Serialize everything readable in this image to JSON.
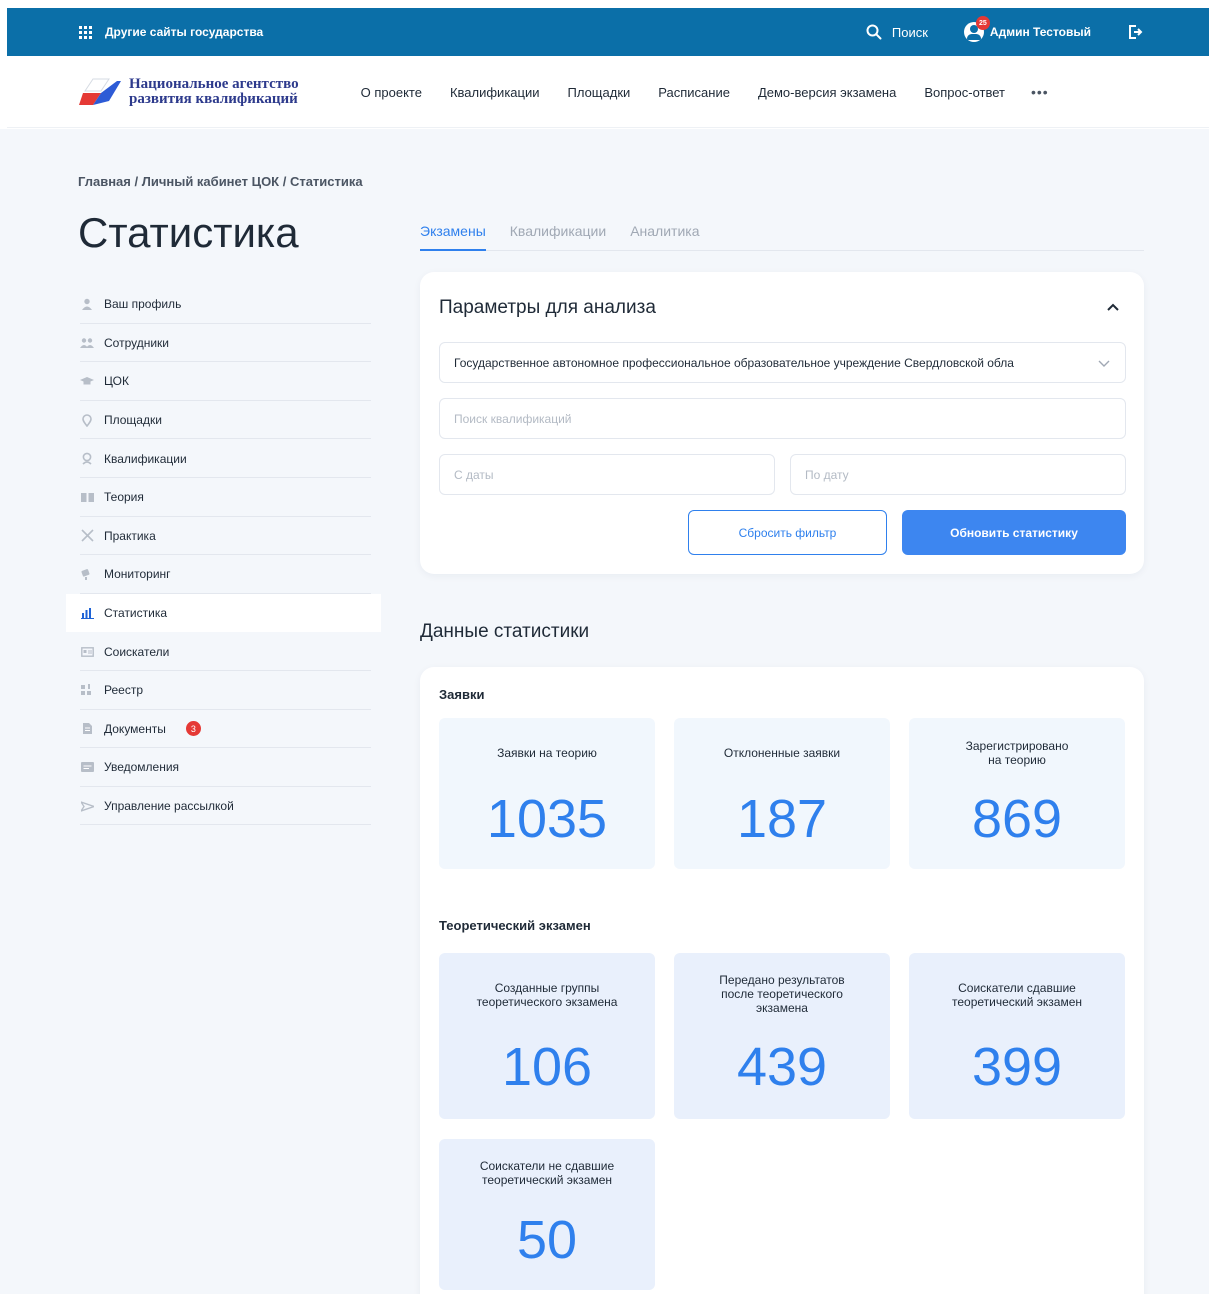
{
  "gov_bar": {
    "other_sites_label": "Другие сайты государства",
    "search_label": "Поиск",
    "user_name": "Админ Тестовый",
    "notifications_count": "25"
  },
  "header": {
    "logo_line1": "Национальное агентство",
    "logo_line2": "развития квалификаций",
    "nav": [
      "О проекте",
      "Квалификации",
      "Площадки",
      "Расписание",
      "Демо-версия экзамена",
      "Вопрос-ответ"
    ],
    "more_label": "•••"
  },
  "breadcrumb": "Главная / Личный кабинет ЦОК / Статистика",
  "page_title": "Статистика",
  "sidebar": {
    "items": [
      {
        "label": "Ваш профиль",
        "icon": "person-icon"
      },
      {
        "label": "Сотрудники",
        "icon": "people-icon"
      },
      {
        "label": "ЦОК",
        "icon": "graduation-cap-icon"
      },
      {
        "label": "Площадки",
        "icon": "location-pin-icon"
      },
      {
        "label": "Квалификации",
        "icon": "award-icon"
      },
      {
        "label": "Теория",
        "icon": "book-icon"
      },
      {
        "label": "Практика",
        "icon": "tools-icon"
      },
      {
        "label": "Мониторинг",
        "icon": "video-camera-icon"
      },
      {
        "label": "Статистика",
        "icon": "bar-chart-icon"
      },
      {
        "label": "Соискатели",
        "icon": "id-card-icon"
      },
      {
        "label": "Реестр",
        "icon": "registry-icon"
      },
      {
        "label": "Документы",
        "icon": "document-icon",
        "badge": "3"
      },
      {
        "label": "Уведомления",
        "icon": "message-icon"
      },
      {
        "label": "Управление рассылкой",
        "icon": "send-icon"
      }
    ],
    "active_index": 8
  },
  "tabs": [
    {
      "label": "Экзамены",
      "active": true
    },
    {
      "label": "Квалификации",
      "active": false
    },
    {
      "label": "Аналитика",
      "active": false
    }
  ],
  "params": {
    "title": "Параметры для анализа",
    "organization_value": "Государственное автономное профессиональное образовательное учреждение Свердловской обла",
    "search_placeholder": "Поиск квалификаций",
    "date_from_placeholder": "С даты",
    "date_to_placeholder": "По дату",
    "reset_label": "Сбросить фильтр",
    "update_label": "Обновить статистику"
  },
  "stats": {
    "title": "Данные статистики",
    "applications": {
      "label": "Заявки",
      "tiles": [
        {
          "label": "Заявки на теорию",
          "value": "1035"
        },
        {
          "label": "Отклоненные заявки",
          "value": "187"
        },
        {
          "label": "Зарегистрировано\nна теорию",
          "value": "869"
        }
      ]
    },
    "theory_exam": {
      "label": "Теоретический экзамен",
      "tiles": [
        {
          "label": "Созданные группы\nтеоретического экзамена",
          "value": "106"
        },
        {
          "label": "Передано результатов\nпосле теоретического\nэкзамена",
          "value": "439"
        },
        {
          "label": "Соискатели сдавшие\nтеоретический экзамен",
          "value": "399"
        },
        {
          "label": "Соискатели не сдавшие\nтеоретический экзамен",
          "value": "50"
        }
      ]
    }
  },
  "colors": {
    "gov_bar": "#0b6fa8",
    "accent": "#2f80ed",
    "badge": "#e53935",
    "page_bg": "#f4f7fb"
  }
}
